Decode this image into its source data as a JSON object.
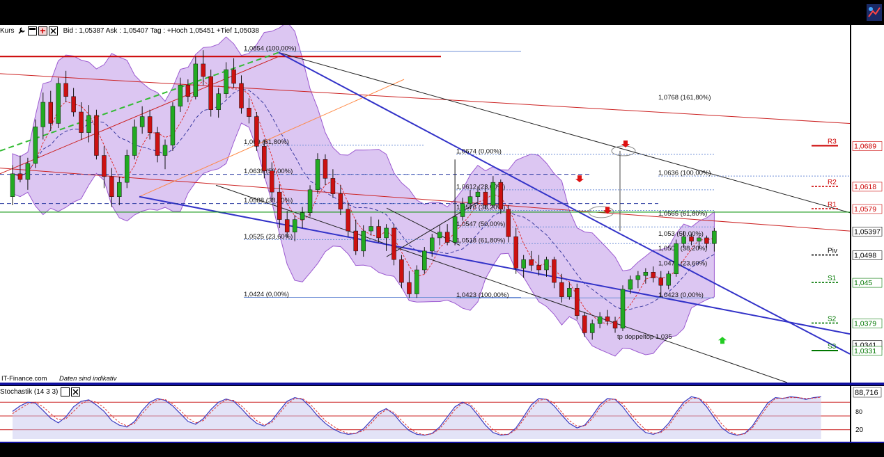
{
  "toolbar": {
    "instrument_label": "Kurs",
    "quote_text": "Bid : 1,05387 Ask : 1,05407  Tag : +Hoch 1,05451 +Tief 1,05038",
    "buttons": [
      "wrench-icon",
      "window-icon",
      "minimize-icon",
      "close-icon"
    ]
  },
  "footer": {
    "source_text": "IT-Finance.com",
    "disclaimer_text": "Daten sind indikativ"
  },
  "stochastic": {
    "label": "Stochastik (14 3 3)",
    "value_label": "88,716",
    "level_80_label": "80",
    "level_20_label": "20",
    "k_values": [
      60,
      72,
      80,
      78,
      62,
      45,
      35,
      48,
      70,
      82,
      85,
      74,
      60,
      40,
      30,
      26,
      38,
      62,
      80,
      88,
      84,
      72,
      55,
      38,
      32,
      44,
      64,
      80,
      87,
      82,
      66,
      48,
      34,
      28,
      40,
      62,
      82,
      90,
      86,
      70,
      50,
      34,
      22,
      14,
      10,
      12,
      22,
      40,
      58,
      66,
      54,
      34,
      18,
      10,
      8,
      12,
      26,
      48,
      70,
      80,
      72,
      52,
      30,
      14,
      8,
      10,
      24,
      48,
      74,
      88,
      86,
      72,
      52,
      34,
      24,
      30,
      50,
      74,
      88,
      86,
      70,
      48,
      28,
      14,
      10,
      16,
      34,
      58,
      80,
      92,
      88,
      70,
      46,
      24,
      12,
      8,
      12,
      28,
      54,
      78,
      90,
      88,
      92,
      90,
      86,
      90,
      92
    ],
    "d_values": [
      55,
      66,
      76,
      80,
      70,
      55,
      42,
      44,
      60,
      76,
      84,
      80,
      68,
      50,
      36,
      28,
      34,
      55,
      74,
      85,
      86,
      76,
      62,
      45,
      35,
      40,
      58,
      74,
      85,
      84,
      72,
      56,
      40,
      30,
      36,
      56,
      76,
      88,
      88,
      76,
      58,
      40,
      28,
      18,
      12,
      12,
      18,
      34,
      52,
      64,
      58,
      40,
      24,
      13,
      9,
      11,
      22,
      42,
      64,
      78,
      76,
      58,
      38,
      20,
      10,
      10,
      20,
      42,
      66,
      84,
      87,
      78,
      58,
      40,
      28,
      28,
      44,
      68,
      84,
      87,
      76,
      56,
      36,
      20,
      12,
      14,
      28,
      52,
      74,
      88,
      89,
      76,
      54,
      32,
      16,
      9,
      11,
      24,
      48,
      72,
      88,
      89,
      90,
      90,
      88,
      89,
      91
    ]
  },
  "yaxis_labels": [
    {
      "text": "1,0689",
      "value": 1.0689,
      "color": "#cc0000"
    },
    {
      "text": "1,0618",
      "value": 1.0618,
      "color": "#cc0000"
    },
    {
      "text": "1,0579",
      "value": 1.0579,
      "color": "#cc0000"
    },
    {
      "text": "1,05397",
      "value": 1.05397,
      "color": "#000000"
    },
    {
      "text": "1,0498",
      "value": 1.0498,
      "color": "#000000"
    },
    {
      "text": "1,045",
      "value": 1.045,
      "color": "#007700"
    },
    {
      "text": "1,0379",
      "value": 1.0379,
      "color": "#007700"
    },
    {
      "text": "1,0341",
      "value": 1.0341,
      "color": "#000000"
    },
    {
      "text": "1,0331",
      "value": 1.0331,
      "color": "#007700"
    }
  ],
  "chart_data": {
    "type": "candlestick",
    "title": "",
    "ylim": [
      1.0275,
      1.09
    ],
    "grid": false,
    "candles": [
      {
        "o": 1.06,
        "h": 1.0655,
        "l": 1.0585,
        "c": 1.064
      },
      {
        "o": 1.064,
        "h": 1.0672,
        "l": 1.0625,
        "c": 1.063
      },
      {
        "o": 1.063,
        "h": 1.0668,
        "l": 1.0612,
        "c": 1.0658
      },
      {
        "o": 1.0658,
        "h": 1.0735,
        "l": 1.065,
        "c": 1.0722
      },
      {
        "o": 1.0722,
        "h": 1.0782,
        "l": 1.07,
        "c": 1.0765
      },
      {
        "o": 1.0765,
        "h": 1.0785,
        "l": 1.0715,
        "c": 1.0728
      },
      {
        "o": 1.0728,
        "h": 1.0808,
        "l": 1.072,
        "c": 1.0798
      },
      {
        "o": 1.0798,
        "h": 1.082,
        "l": 1.0765,
        "c": 1.0775
      },
      {
        "o": 1.0775,
        "h": 1.079,
        "l": 1.074,
        "c": 1.0748
      },
      {
        "o": 1.0748,
        "h": 1.0765,
        "l": 1.07,
        "c": 1.0712
      },
      {
        "o": 1.0712,
        "h": 1.076,
        "l": 1.0695,
        "c": 1.0742
      },
      {
        "o": 1.0742,
        "h": 1.0752,
        "l": 1.0665,
        "c": 1.0672
      },
      {
        "o": 1.0672,
        "h": 1.0688,
        "l": 1.0615,
        "c": 1.0635
      },
      {
        "o": 1.0635,
        "h": 1.065,
        "l": 1.0582,
        "c": 1.06
      },
      {
        "o": 1.06,
        "h": 1.0635,
        "l": 1.0585,
        "c": 1.0625
      },
      {
        "o": 1.0625,
        "h": 1.0682,
        "l": 1.0615,
        "c": 1.0672
      },
      {
        "o": 1.0672,
        "h": 1.0735,
        "l": 1.0665,
        "c": 1.0722
      },
      {
        "o": 1.0722,
        "h": 1.0758,
        "l": 1.071,
        "c": 1.074
      },
      {
        "o": 1.074,
        "h": 1.0752,
        "l": 1.07,
        "c": 1.0712
      },
      {
        "o": 1.0712,
        "h": 1.0722,
        "l": 1.066,
        "c": 1.0672
      },
      {
        "o": 1.0672,
        "h": 1.07,
        "l": 1.0648,
        "c": 1.069
      },
      {
        "o": 1.069,
        "h": 1.0765,
        "l": 1.068,
        "c": 1.0758
      },
      {
        "o": 1.0758,
        "h": 1.0808,
        "l": 1.0748,
        "c": 1.0795
      },
      {
        "o": 1.0795,
        "h": 1.0805,
        "l": 1.0765,
        "c": 1.0775
      },
      {
        "o": 1.0775,
        "h": 1.0845,
        "l": 1.077,
        "c": 1.0832
      },
      {
        "o": 1.0832,
        "h": 1.0856,
        "l": 1.0795,
        "c": 1.081
      },
      {
        "o": 1.081,
        "h": 1.0822,
        "l": 1.074,
        "c": 1.0752
      },
      {
        "o": 1.0752,
        "h": 1.079,
        "l": 1.0738,
        "c": 1.078
      },
      {
        "o": 1.078,
        "h": 1.0835,
        "l": 1.0772,
        "c": 1.0822
      },
      {
        "o": 1.0822,
        "h": 1.0842,
        "l": 1.079,
        "c": 1.0798
      },
      {
        "o": 1.0798,
        "h": 1.0812,
        "l": 1.0745,
        "c": 1.0755
      },
      {
        "o": 1.0755,
        "h": 1.0772,
        "l": 1.0728,
        "c": 1.074
      },
      {
        "o": 1.074,
        "h": 1.0748,
        "l": 1.068,
        "c": 1.0688
      },
      {
        "o": 1.0688,
        "h": 1.07,
        "l": 1.0632,
        "c": 1.0645
      },
      {
        "o": 1.0645,
        "h": 1.066,
        "l": 1.0595,
        "c": 1.0608
      },
      {
        "o": 1.0608,
        "h": 1.0622,
        "l": 1.0545,
        "c": 1.056
      },
      {
        "o": 1.056,
        "h": 1.0575,
        "l": 1.0528,
        "c": 1.0538
      },
      {
        "o": 1.0538,
        "h": 1.0568,
        "l": 1.0522,
        "c": 1.056
      },
      {
        "o": 1.056,
        "h": 1.0582,
        "l": 1.0545,
        "c": 1.0572
      },
      {
        "o": 1.0572,
        "h": 1.062,
        "l": 1.0565,
        "c": 1.0612
      },
      {
        "o": 1.0612,
        "h": 1.0676,
        "l": 1.0605,
        "c": 1.0665
      },
      {
        "o": 1.0665,
        "h": 1.0674,
        "l": 1.062,
        "c": 1.0632
      },
      {
        "o": 1.0632,
        "h": 1.0648,
        "l": 1.0598,
        "c": 1.0605
      },
      {
        "o": 1.0605,
        "h": 1.062,
        "l": 1.0568,
        "c": 1.0578
      },
      {
        "o": 1.0578,
        "h": 1.059,
        "l": 1.053,
        "c": 1.054
      },
      {
        "o": 1.054,
        "h": 1.056,
        "l": 1.0498,
        "c": 1.0505
      },
      {
        "o": 1.0505,
        "h": 1.055,
        "l": 1.0495,
        "c": 1.054
      },
      {
        "o": 1.054,
        "h": 1.0565,
        "l": 1.0532,
        "c": 1.0548
      },
      {
        "o": 1.0548,
        "h": 1.056,
        "l": 1.052,
        "c": 1.0528
      },
      {
        "o": 1.0528,
        "h": 1.0552,
        "l": 1.0505,
        "c": 1.0545
      },
      {
        "o": 1.0545,
        "h": 1.0552,
        "l": 1.048,
        "c": 1.049
      },
      {
        "o": 1.049,
        "h": 1.0498,
        "l": 1.044,
        "c": 1.045
      },
      {
        "o": 1.045,
        "h": 1.047,
        "l": 1.0423,
        "c": 1.043
      },
      {
        "o": 1.043,
        "h": 1.048,
        "l": 1.0423,
        "c": 1.0472
      },
      {
        "o": 1.0472,
        "h": 1.0512,
        "l": 1.0465,
        "c": 1.0505
      },
      {
        "o": 1.0505,
        "h": 1.0535,
        "l": 1.0495,
        "c": 1.0528
      },
      {
        "o": 1.0528,
        "h": 1.055,
        "l": 1.0515,
        "c": 1.0538
      },
      {
        "o": 1.0538,
        "h": 1.0552,
        "l": 1.0515,
        "c": 1.052
      },
      {
        "o": 1.052,
        "h": 1.0665,
        "l": 1.0515,
        "c": 1.0565
      },
      {
        "o": 1.0565,
        "h": 1.0598,
        "l": 1.0558,
        "c": 1.0588
      },
      {
        "o": 1.0588,
        "h": 1.0612,
        "l": 1.0578,
        "c": 1.06
      },
      {
        "o": 1.06,
        "h": 1.0618,
        "l": 1.0585,
        "c": 1.0608
      },
      {
        "o": 1.0608,
        "h": 1.062,
        "l": 1.0578,
        "c": 1.0585
      },
      {
        "o": 1.0585,
        "h": 1.0636,
        "l": 1.058,
        "c": 1.0625
      },
      {
        "o": 1.0625,
        "h": 1.063,
        "l": 1.057,
        "c": 1.0578
      },
      {
        "o": 1.0578,
        "h": 1.0585,
        "l": 1.052,
        "c": 1.053
      },
      {
        "o": 1.053,
        "h": 1.0545,
        "l": 1.0465,
        "c": 1.0475
      },
      {
        "o": 1.0475,
        "h": 1.0498,
        "l": 1.0458,
        "c": 1.049
      },
      {
        "o": 1.049,
        "h": 1.0505,
        "l": 1.047,
        "c": 1.048
      },
      {
        "o": 1.048,
        "h": 1.0498,
        "l": 1.0462,
        "c": 1.0472
      },
      {
        "o": 1.0472,
        "h": 1.0495,
        "l": 1.046,
        "c": 1.049
      },
      {
        "o": 1.049,
        "h": 1.0495,
        "l": 1.044,
        "c": 1.045
      },
      {
        "o": 1.045,
        "h": 1.0465,
        "l": 1.0415,
        "c": 1.0425
      },
      {
        "o": 1.0425,
        "h": 1.045,
        "l": 1.042,
        "c": 1.044
      },
      {
        "o": 1.044,
        "h": 1.0448,
        "l": 1.0385,
        "c": 1.0392
      },
      {
        "o": 1.0392,
        "h": 1.0398,
        "l": 1.0355,
        "c": 1.0362
      },
      {
        "o": 1.0362,
        "h": 1.0385,
        "l": 1.035,
        "c": 1.0378
      },
      {
        "o": 1.0378,
        "h": 1.0398,
        "l": 1.037,
        "c": 1.039
      },
      {
        "o": 1.039,
        "h": 1.0402,
        "l": 1.0375,
        "c": 1.0382
      },
      {
        "o": 1.0382,
        "h": 1.039,
        "l": 1.0362,
        "c": 1.037
      },
      {
        "o": 1.037,
        "h": 1.0445,
        "l": 1.0365,
        "c": 1.0438
      },
      {
        "o": 1.0438,
        "h": 1.0462,
        "l": 1.043,
        "c": 1.0455
      },
      {
        "o": 1.0455,
        "h": 1.047,
        "l": 1.044,
        "c": 1.0462
      },
      {
        "o": 1.0462,
        "h": 1.0475,
        "l": 1.0448,
        "c": 1.0468
      },
      {
        "o": 1.0468,
        "h": 1.0478,
        "l": 1.045,
        "c": 1.0458
      },
      {
        "o": 1.0458,
        "h": 1.047,
        "l": 1.0425,
        "c": 1.0445
      },
      {
        "o": 1.0445,
        "h": 1.047,
        "l": 1.0438,
        "c": 1.0465
      },
      {
        "o": 1.0465,
        "h": 1.0525,
        "l": 1.046,
        "c": 1.0518
      },
      {
        "o": 1.0518,
        "h": 1.054,
        "l": 1.051,
        "c": 1.053
      },
      {
        "o": 1.053,
        "h": 1.0535,
        "l": 1.0515,
        "c": 1.0522
      },
      {
        "o": 1.0522,
        "h": 1.0532,
        "l": 1.0508,
        "c": 1.0528
      },
      {
        "o": 1.0528,
        "h": 1.0532,
        "l": 1.051,
        "c": 1.0518
      },
      {
        "o": 1.0518,
        "h": 1.0545,
        "l": 1.0504,
        "c": 1.054
      }
    ],
    "annotations": [
      {
        "text": "1,0854 (100,00%)",
        "value": 1.0854
      },
      {
        "text": "1,0768 (161,80%)",
        "value": 1.0768
      },
      {
        "text": "1,069 (61,80%)",
        "value": 1.069
      },
      {
        "text": "1,0674 (0,00%)",
        "value": 1.0674
      },
      {
        "text": "1,0639 (50,00%)",
        "value": 1.0639
      },
      {
        "text": "1,0636 (100,00%)",
        "value": 1.0636
      },
      {
        "text": "1,0612 (23,60%)",
        "value": 1.0612
      },
      {
        "text": "1,0588 (38,20%)",
        "value": 1.0588
      },
      {
        "text": "1,0576 (38,20%)",
        "value": 1.0576
      },
      {
        "text": "1,0565 (61,80%)",
        "value": 1.0565
      },
      {
        "text": "1,0547 (50,00%)",
        "value": 1.0547
      },
      {
        "text": "1,053 (50,00%)",
        "value": 1.053
      },
      {
        "text": "1,0525 (23,60%)",
        "value": 1.0525
      },
      {
        "text": "1,0518 (61,80%)",
        "value": 1.0518
      },
      {
        "text": "1,0504 (38,20%)",
        "value": 1.0504
      },
      {
        "text": "1,0478 (23,60%)",
        "value": 1.0478
      },
      {
        "text": "1,0424 (0,00%)",
        "value": 1.0424
      },
      {
        "text": "1,0423 (100,00%)",
        "value": 1.0423
      },
      {
        "text": "1,0423 (0,00%)",
        "value": 1.0423
      },
      {
        "text": "tp doppeltop 1,035",
        "value": 1.035
      }
    ],
    "pivots": [
      {
        "name": "R3",
        "value": 1.0689,
        "color": "#cc0000"
      },
      {
        "name": "R2",
        "value": 1.0618,
        "color": "#cc0000"
      },
      {
        "name": "R1",
        "value": 1.0579,
        "color": "#cc0000"
      },
      {
        "name": "Piv",
        "value": 1.0498,
        "color": "#000000"
      },
      {
        "name": "S1",
        "value": 1.045,
        "color": "#007700"
      },
      {
        "name": "S2",
        "value": 1.0379,
        "color": "#007700"
      },
      {
        "name": "S3",
        "value": 1.0331,
        "color": "#007700"
      }
    ],
    "colors": {
      "up": "#22aa22",
      "down": "#cc1111",
      "band_fill": "#dcc6f2",
      "band_edge": "#9b59d0",
      "blue_trend": "#3232c8",
      "red_channel": "#cc2222",
      "green_line": "#1a9a1a",
      "fib_blue": "#6f8fd6"
    }
  }
}
